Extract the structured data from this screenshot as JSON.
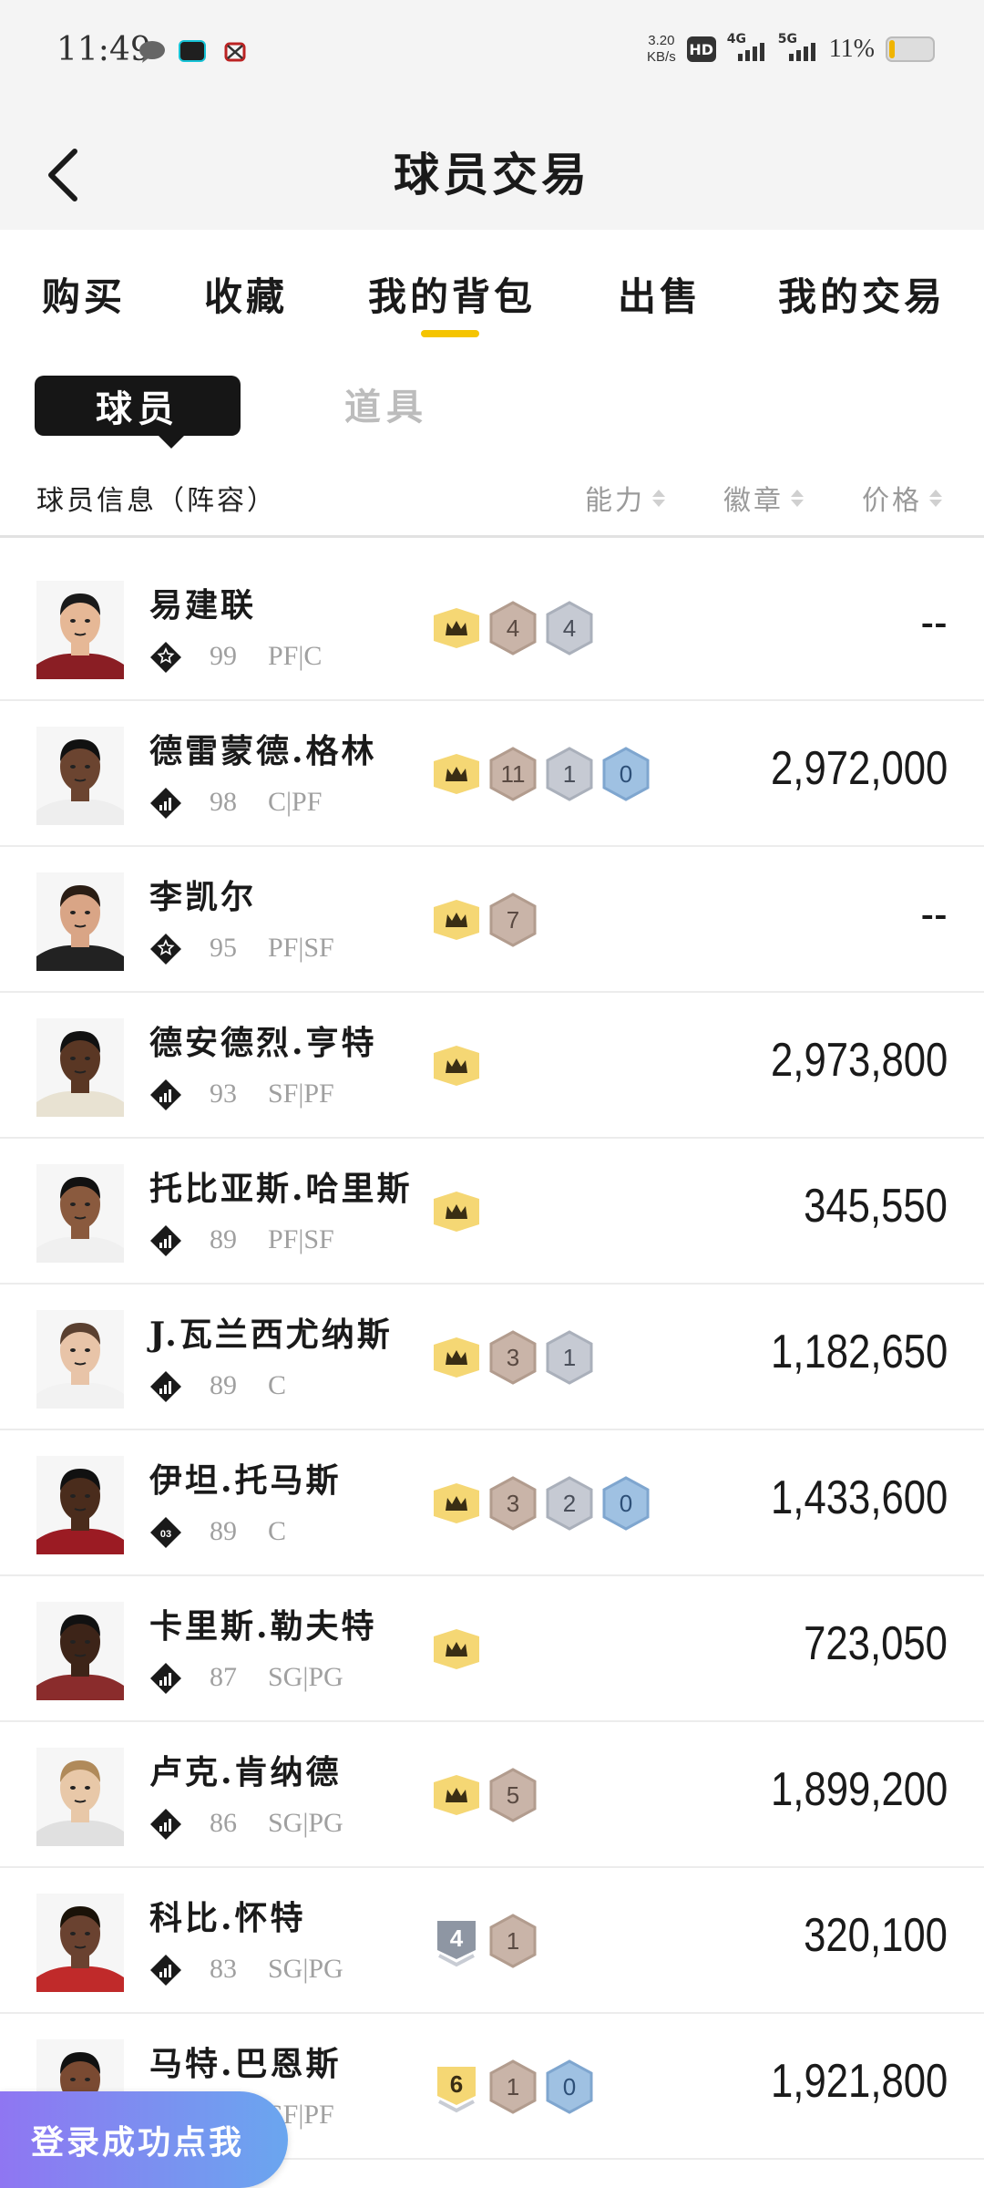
{
  "status_bar": {
    "time": "11:49",
    "net_speed_value": "3.20",
    "net_speed_unit": "KB/s",
    "hd_label": "HD",
    "sim1_label": "4G",
    "sim2_label": "5G",
    "battery_percent": "11%"
  },
  "header": {
    "title": "球员交易"
  },
  "tabs": [
    {
      "label": "购买"
    },
    {
      "label": "收藏"
    },
    {
      "label": "我的背包",
      "active": true
    },
    {
      "label": "出售"
    },
    {
      "label": "我的交易"
    }
  ],
  "subtabs": {
    "active": "球员",
    "inactive": "道具"
  },
  "columns": {
    "info": "球员信息（阵容）",
    "ability": "能力",
    "badge": "徽章",
    "price": "价格"
  },
  "colors": {
    "accent": "#f5c400",
    "crown_badge": "#f5d774",
    "bronze_badge": "#c9b4a8",
    "silver_badge": "#c6cad3",
    "blue_badge": "#9fc1e2"
  },
  "players": [
    {
      "name": "易建联",
      "rating": "99",
      "position": "PF|C",
      "tier_icon": "star-icon",
      "badges": [
        {
          "type": "crown"
        },
        {
          "type": "bronze",
          "count": "4"
        },
        {
          "type": "silver",
          "count": "4"
        }
      ],
      "price": "--"
    },
    {
      "name": "德雷蒙德.格林",
      "rating": "98",
      "position": "C|PF",
      "tier_icon": "bars-icon",
      "badges": [
        {
          "type": "crown"
        },
        {
          "type": "bronze",
          "count": "11"
        },
        {
          "type": "silver",
          "count": "1"
        },
        {
          "type": "blue",
          "count": "0"
        }
      ],
      "price": "2,972,000"
    },
    {
      "name": "李凯尔",
      "rating": "95",
      "position": "PF|SF",
      "tier_icon": "star-icon",
      "badges": [
        {
          "type": "crown"
        },
        {
          "type": "bronze",
          "count": "7"
        }
      ],
      "price": "--"
    },
    {
      "name": "德安德烈.亨特",
      "rating": "93",
      "position": "SF|PF",
      "tier_icon": "bars-icon",
      "badges": [
        {
          "type": "crown"
        }
      ],
      "price": "2,973,800"
    },
    {
      "name": "托比亚斯.哈里斯",
      "rating": "89",
      "position": "PF|SF",
      "tier_icon": "bars-icon",
      "badges": [
        {
          "type": "crown"
        }
      ],
      "price": "345,550"
    },
    {
      "name": "J.瓦兰西尤纳斯",
      "rating": "89",
      "position": "C",
      "tier_icon": "bars-icon",
      "badges": [
        {
          "type": "crown"
        },
        {
          "type": "bronze",
          "count": "3"
        },
        {
          "type": "silver",
          "count": "1"
        }
      ],
      "price": "1,182,650"
    },
    {
      "name": "伊坦.托马斯",
      "rating": "89",
      "position": "C",
      "tier_icon": "03",
      "badges": [
        {
          "type": "crown"
        },
        {
          "type": "bronze",
          "count": "3"
        },
        {
          "type": "silver",
          "count": "2"
        },
        {
          "type": "blue",
          "count": "0"
        }
      ],
      "price": "1,433,600"
    },
    {
      "name": "卡里斯.勒夫特",
      "rating": "87",
      "position": "SG|PG",
      "tier_icon": "bars-icon",
      "badges": [
        {
          "type": "crown"
        }
      ],
      "price": "723,050"
    },
    {
      "name": "卢克.肯纳德",
      "rating": "86",
      "position": "SG|PG",
      "tier_icon": "bars-icon",
      "badges": [
        {
          "type": "crown"
        },
        {
          "type": "bronze",
          "count": "5"
        }
      ],
      "price": "1,899,200"
    },
    {
      "name": "科比.怀特",
      "rating": "83",
      "position": "SG|PG",
      "tier_icon": "bars-icon",
      "badges": [
        {
          "type": "rank",
          "count": "4"
        },
        {
          "type": "bronze",
          "count": "1"
        }
      ],
      "price": "320,100"
    },
    {
      "name": "马特.巴恩斯",
      "rating": "",
      "position": "SF|PF",
      "tier_icon": "bars-icon",
      "badges": [
        {
          "type": "gold-rank",
          "count": "6"
        },
        {
          "type": "bronze",
          "count": "1"
        },
        {
          "type": "blue",
          "count": "0"
        }
      ],
      "price": "1,921,800"
    }
  ],
  "floating_button": {
    "label": "登录成功点我"
  }
}
